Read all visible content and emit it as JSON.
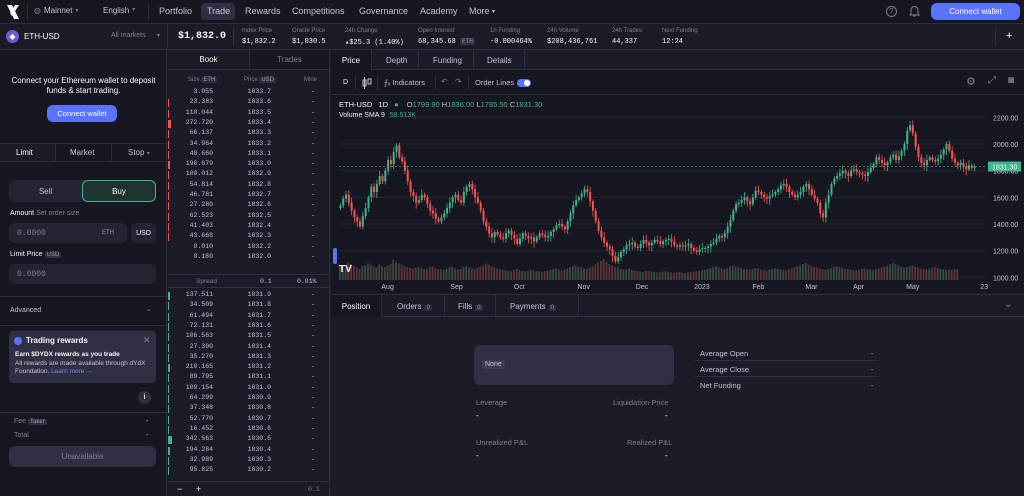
{
  "nav": {
    "network": "Mainnet",
    "language": "English",
    "links": [
      "Portfolio",
      "Trade",
      "Rewards",
      "Competitions",
      "Governance",
      "Academy",
      "More"
    ],
    "connect_label": "Connect wallet"
  },
  "market": {
    "symbol": "ETH-USD",
    "all_markets": "All markets",
    "price": "$1,832.0",
    "stats": [
      {
        "label": "Index Price",
        "value": "$1,832.2"
      },
      {
        "label": "Oracle Price",
        "value": "$1,830.5"
      },
      {
        "label": "24h Change",
        "value": "▴$25.3 (1.40%)"
      },
      {
        "label": "Open Interest",
        "value": "68,345.68",
        "unit": "ETH"
      },
      {
        "label": "1h Funding",
        "value": "-0.000464%"
      },
      {
        "label": "24h Volume",
        "value": "$208,436,761"
      },
      {
        "label": "24h Trades",
        "value": "44,337"
      },
      {
        "label": "Next Funding",
        "value": "12:24"
      }
    ],
    "colors": {
      "positive": "#3fb68b",
      "negative": "#ff5353",
      "accent": "#5973fe"
    }
  },
  "sidebar": {
    "connect_msg": "Connect your Ethereum wallet to deposit funds & start trading.",
    "connect_button": "Connect wallet",
    "order_tabs": [
      "Limit",
      "Market",
      "Stop"
    ],
    "sell": "Sell",
    "buy": "Buy",
    "amount_label": "Amount",
    "amount_hint": "Set order size",
    "amount_value": "0.0000",
    "amount_unit": "ETH",
    "amount_alt_unit": "USD",
    "limit_label": "Limit Price",
    "limit_unit": "USD",
    "limit_value": "0.0000",
    "advanced": "Advanced",
    "rewards_title": "Trading rewards",
    "rewards_line1": "Earn $DYDX rewards as you trade",
    "rewards_line2": "All rewards are made available through dYdX Foundation.",
    "rewards_link": "Learn more →",
    "fee_label": "Fee",
    "fee_tag": "Taker",
    "fee_value": "-",
    "total_label": "Total",
    "total_value": "-",
    "unavailable": "Unavailable"
  },
  "book": {
    "tabs": [
      "Book",
      "Trades"
    ],
    "headers": {
      "size": "Size",
      "size_unit": "ETH",
      "price": "Price",
      "price_unit": "USD",
      "mine": "Mine"
    },
    "asks": [
      [
        "3.055",
        "1833.7"
      ],
      [
        "23.383",
        "1833.6"
      ],
      [
        "110.044",
        "1833.5"
      ],
      [
        "272.720",
        "1833.4"
      ],
      [
        "66.137",
        "1833.3"
      ],
      [
        "34.964",
        "1833.2"
      ],
      [
        "48.660",
        "1833.1"
      ],
      [
        "190.679",
        "1833.0"
      ],
      [
        "100.012",
        "1832.9"
      ],
      [
        "54.814",
        "1832.8"
      ],
      [
        "46.781",
        "1832.7"
      ],
      [
        "27.280",
        "1832.6"
      ],
      [
        "62.523",
        "1832.5"
      ],
      [
        "41.403",
        "1832.4"
      ],
      [
        "43.668",
        "1832.3"
      ],
      [
        "0.010",
        "1832.2"
      ],
      [
        "0.180",
        "1832.0"
      ]
    ],
    "spread_label": "Spread",
    "spread_value": "0.1",
    "spread_pct": "0.01%",
    "bids": [
      [
        "137.511",
        "1831.9"
      ],
      [
        "34.509",
        "1831.8"
      ],
      [
        "61.494",
        "1831.7"
      ],
      [
        "72.131",
        "1831.6"
      ],
      [
        "106.563",
        "1831.5"
      ],
      [
        "27.300",
        "1831.4"
      ],
      [
        "35.270",
        "1831.3"
      ],
      [
        "210.165",
        "1831.2"
      ],
      [
        "89.795",
        "1831.1"
      ],
      [
        "109.154",
        "1831.0"
      ],
      [
        "64.299",
        "1830.9"
      ],
      [
        "37.348",
        "1830.8"
      ],
      [
        "52.770",
        "1830.7"
      ],
      [
        "16.452",
        "1830.6"
      ],
      [
        "342.563",
        "1830.5"
      ],
      [
        "194.284",
        "1830.4"
      ],
      [
        "32.989",
        "1830.3"
      ],
      [
        "95.825",
        "1830.2"
      ]
    ],
    "mine_value": "-",
    "minus": "−",
    "plus": "+",
    "step": "0.1"
  },
  "chart": {
    "tabs": [
      "Price",
      "Depth",
      "Funding",
      "Details"
    ],
    "interval": "D",
    "indicators_label": "Indicators",
    "order_lines_label": "Order Lines",
    "legend_symbol": "ETH-USD",
    "legend_interval": "1D",
    "legend_o": "1799.90",
    "legend_h": "1836.00",
    "legend_l": "1785.50",
    "legend_c": "1831.30",
    "volume_label": "Volume SMA 9",
    "volume_value": "58.513K",
    "price_tag": "1831.30",
    "logo": "TV"
  },
  "chart_data": {
    "type": "candlestick",
    "title": "ETH-USD 1D",
    "x_labels": [
      "Aug",
      "Sep",
      "Oct",
      "Nov",
      "Dec",
      "2023",
      "Feb",
      "Mar",
      "Apr",
      "May",
      "23"
    ],
    "y_ticks": [
      1000,
      1200,
      1400,
      1600,
      1800,
      2000,
      2200
    ],
    "ylim": [
      980,
      2300
    ],
    "closes": [
      1540,
      1590,
      1620,
      1560,
      1500,
      1450,
      1420,
      1380,
      1460,
      1520,
      1600,
      1680,
      1640,
      1700,
      1760,
      1720,
      1800,
      1880,
      1850,
      1940,
      1990,
      1900,
      1870,
      1800,
      1720,
      1640,
      1610,
      1560,
      1580,
      1620,
      1600,
      1550,
      1500,
      1480,
      1440,
      1420,
      1450,
      1480,
      1520,
      1560,
      1600,
      1620,
      1580,
      1560,
      1640,
      1680,
      1700,
      1660,
      1600,
      1560,
      1500,
      1420,
      1380,
      1330,
      1300,
      1340,
      1320,
      1300,
      1290,
      1330,
      1350,
      1320,
      1290,
      1250,
      1290,
      1330,
      1310,
      1290,
      1300,
      1270,
      1300,
      1330,
      1320,
      1300,
      1310,
      1340,
      1360,
      1390,
      1400,
      1380,
      1360,
      1420,
      1480,
      1540,
      1580,
      1600,
      1630,
      1660,
      1640,
      1570,
      1500,
      1420,
      1350,
      1300,
      1260,
      1230,
      1210,
      1160,
      1120,
      1150,
      1190,
      1210,
      1240,
      1250,
      1260,
      1230,
      1220,
      1250,
      1280,
      1260,
      1240,
      1260,
      1280,
      1270,
      1250,
      1270,
      1280,
      1290,
      1270,
      1240,
      1230,
      1240,
      1230,
      1240,
      1250,
      1220,
      1200,
      1190,
      1210,
      1220,
      1220,
      1230,
      1250,
      1260,
      1290,
      1310,
      1300,
      1330,
      1380,
      1430,
      1500,
      1550,
      1560,
      1580,
      1600,
      1570,
      1550,
      1600,
      1650,
      1640,
      1620,
      1600,
      1590,
      1610,
      1620,
      1640,
      1660,
      1690,
      1700,
      1680,
      1640,
      1620,
      1600,
      1620,
      1640,
      1680,
      1700,
      1660,
      1620,
      1590,
      1560,
      1480,
      1450,
      1560,
      1620,
      1700,
      1740,
      1760,
      1780,
      1800,
      1780,
      1760,
      1800,
      1810,
      1790,
      1780,
      1770,
      1760,
      1790,
      1820,
      1850,
      1900,
      1880,
      1860,
      1840,
      1860,
      1900,
      1920,
      1880,
      1910,
      1950,
      2000,
      2100,
      2140,
      2080,
      1980,
      1900,
      1860,
      1840,
      1880,
      1900,
      1880,
      1870,
      1890,
      1920,
      1960,
      2000,
      1950,
      1890,
      1860,
      1840,
      1860,
      1830,
      1810,
      1840,
      1820,
      1831
    ],
    "volumes": [
      70,
      60,
      55,
      80,
      72,
      65,
      58,
      50,
      62,
      66,
      75,
      68,
      60,
      55,
      70,
      64,
      58,
      66,
      72,
      90,
      80,
      74,
      68,
      62,
      58,
      54,
      50,
      56,
      60,
      54,
      48,
      52,
      58,
      62,
      54,
      50,
      46,
      44,
      50,
      56,
      60,
      52,
      48,
      50,
      58,
      62,
      56,
      52,
      48,
      54,
      60,
      66,
      74,
      70,
      62,
      56,
      52,
      48,
      46,
      44,
      40,
      42,
      46,
      50,
      44,
      40,
      38,
      42,
      46,
      44,
      40,
      38,
      36,
      40,
      44,
      46,
      50,
      52,
      48,
      44,
      46,
      52,
      58,
      62,
      66,
      60,
      56,
      52,
      48,
      54,
      62,
      70,
      78,
      86,
      94,
      80,
      72,
      66,
      60,
      56,
      50,
      46,
      48,
      52,
      46,
      42,
      40,
      38,
      36,
      40,
      42,
      38,
      36,
      34,
      36,
      38,
      40,
      36,
      34,
      32,
      34,
      36,
      32,
      30,
      34,
      36,
      38,
      40,
      42,
      44,
      46,
      50,
      54,
      58,
      62,
      56,
      52,
      48,
      54,
      60,
      66,
      62,
      58,
      54,
      50,
      48,
      46,
      50,
      54,
      52,
      48,
      44,
      42,
      46,
      50,
      54,
      50,
      46,
      44,
      42,
      48,
      52,
      58,
      62,
      66,
      72,
      76,
      70,
      64,
      58,
      56,
      52,
      48,
      46,
      50,
      54,
      58,
      62,
      58,
      54,
      50,
      48,
      46,
      44,
      42,
      46,
      50,
      52,
      48,
      46,
      44,
      48,
      52,
      56,
      60,
      64,
      70,
      76,
      72,
      66,
      60,
      56,
      58,
      62,
      66,
      60,
      56,
      52,
      50,
      48,
      52,
      56,
      60,
      54,
      50,
      48,
      46,
      44,
      46,
      48,
      50
    ]
  },
  "positions": {
    "tabs": [
      {
        "label": "Position",
        "count": ""
      },
      {
        "label": "Orders",
        "count": "0"
      },
      {
        "label": "Fills",
        "count": "0"
      },
      {
        "label": "Payments",
        "count": "0"
      }
    ],
    "none_label": "None",
    "leverage_label": "Leverage",
    "leverage_value": "-",
    "liq_label": "Liquidation Price",
    "liq_value": "-",
    "upnl_label": "Unrealized P&L",
    "upnl_value": "-",
    "rpnl_label": "Realized P&L",
    "rpnl_value": "-",
    "details": [
      {
        "label": "Average Open",
        "value": "-"
      },
      {
        "label": "Average Close",
        "value": "-"
      },
      {
        "label": "Net Funding",
        "value": "-"
      }
    ]
  }
}
